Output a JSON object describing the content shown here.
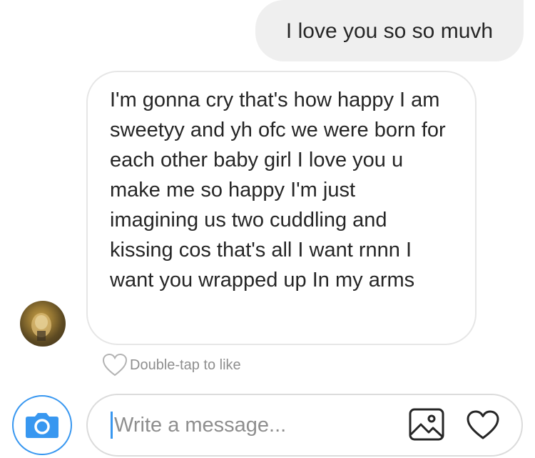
{
  "conversation": {
    "sent_message": "I love you so so muvh",
    "received_message": "I'm gonna cry that's how happy I am sweetyy and yh ofc we were born for each other baby girl I love you u make me so happy I'm just imagining us two cuddling and kissing cos that's all I want rnnn I want you wrapped up In my arms",
    "like_hint": "Double-tap to like"
  },
  "composer": {
    "placeholder": "Write a message...",
    "value": ""
  },
  "icons": {
    "camera": "camera-icon",
    "gallery": "gallery-icon",
    "like": "heart-icon",
    "like_hint": "heart-outline-icon",
    "avatar": "avatar"
  },
  "colors": {
    "accent": "#3897f0",
    "sent_bubble": "#efefef",
    "text": "#262626",
    "muted": "#8e8e8e",
    "border": "#dbdbdb"
  }
}
